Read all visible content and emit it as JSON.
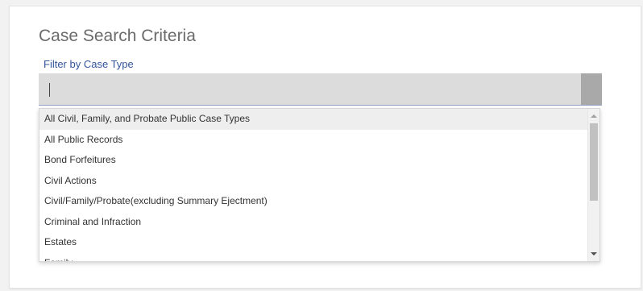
{
  "page": {
    "title": "Case Search Criteria"
  },
  "filter": {
    "label": "Filter by Case Type",
    "input_value": "",
    "placeholder": ""
  },
  "dropdown": {
    "options": [
      "All Civil, Family, and Probate Public Case Types",
      "All Public Records",
      "Bond Forfeitures",
      "Civil Actions",
      "Civil/Family/Probate(excluding Summary Ejectment)",
      "Criminal and Infraction",
      "Estates",
      "Family"
    ],
    "highlighted_index": 0
  },
  "colors": {
    "title": "#6b6b6b",
    "label": "#33559c",
    "input_bg": "#dcdcdc",
    "highlight": "#eeeeee"
  }
}
